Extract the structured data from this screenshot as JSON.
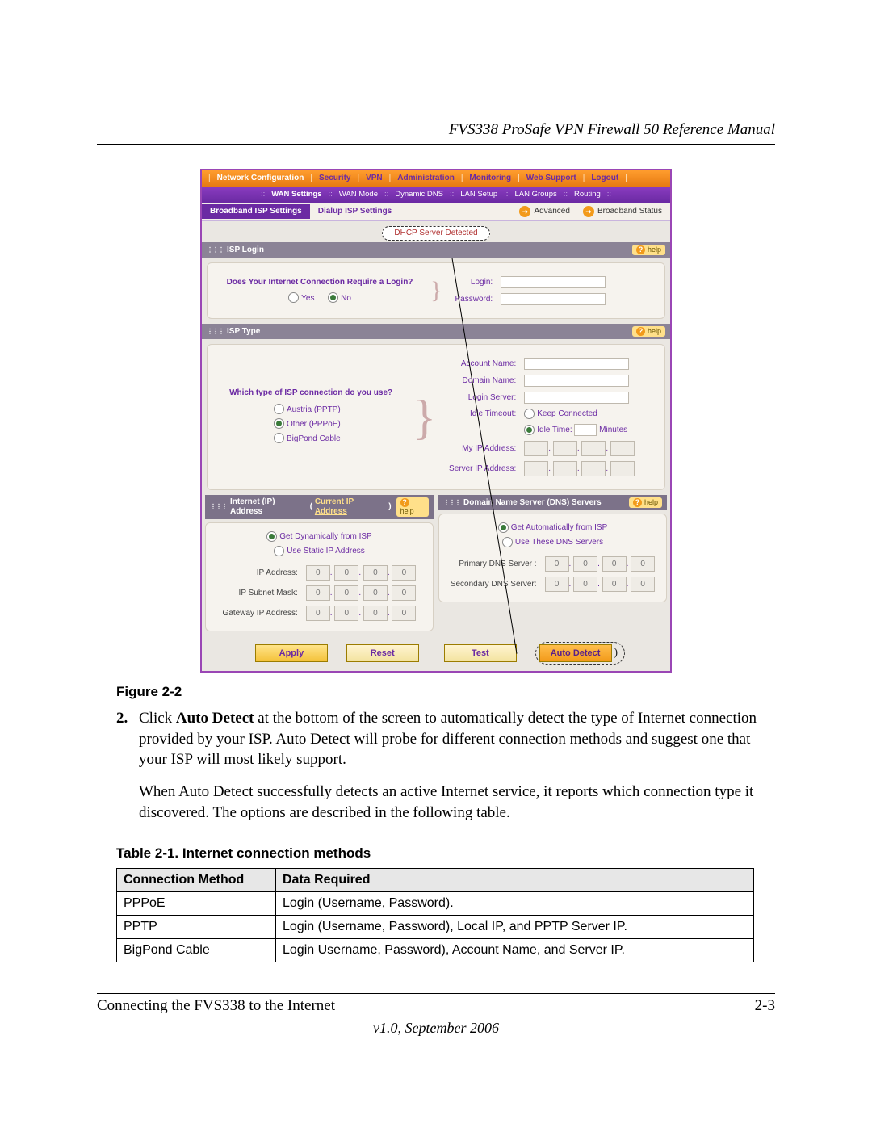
{
  "header_title": "FVS338 ProSafe VPN Firewall 50 Reference Manual",
  "nav": {
    "primary": [
      "Network Configuration",
      "Security",
      "VPN",
      "Administration",
      "Monitoring",
      "Web Support",
      "Logout"
    ],
    "primary_active_index": 0,
    "sub": [
      "WAN Settings",
      "WAN Mode",
      "Dynamic DNS",
      "LAN Setup",
      "LAN Groups",
      "Routing"
    ],
    "sub_active_index": 0
  },
  "tabs": {
    "items": [
      "Broadband ISP Settings",
      "Dialup ISP Settings"
    ],
    "active_index": 0,
    "right_links": {
      "advanced": "Advanced",
      "broadband_status": "Broadband Status"
    }
  },
  "dhcp_pill": "DHCP Server Detected",
  "isp_login": {
    "title": "ISP Login",
    "question": "Does Your Internet Connection Require a Login?",
    "yes": "Yes",
    "no": "No",
    "selected": "no",
    "login_label": "Login:",
    "password_label": "Password:",
    "login_value": "",
    "password_value": ""
  },
  "isp_type": {
    "title": "ISP Type",
    "question": "Which type of ISP connection do you use?",
    "options": {
      "austria": "Austria (PPTP)",
      "other": "Other (PPPoE)",
      "bigpond": "BigPond Cable"
    },
    "selected": "other",
    "labels": {
      "account_name": "Account Name:",
      "domain_name": "Domain Name:",
      "login_server": "Login Server:",
      "idle_timeout": "Idle Timeout:",
      "keep_connected": "Keep Connected",
      "idle_time": "Idle Time:",
      "minutes": "Minutes",
      "my_ip": "My IP Address:",
      "server_ip": "Server IP Address:"
    }
  },
  "ip_section": {
    "title_left": "Internet (IP) Address",
    "current_link": "Current IP Address",
    "opt_dynamic": "Get Dynamically from ISP",
    "opt_static": "Use Static IP Address",
    "selected": "dynamic",
    "labels": {
      "ip": "IP Address:",
      "mask": "IP Subnet Mask:",
      "gw": "Gateway IP Address:"
    },
    "octet_placeholder": "0"
  },
  "dns_section": {
    "title_right": "Domain Name Server (DNS) Servers",
    "opt_auto": "Get Automatically from ISP",
    "opt_manual": "Use These DNS Servers",
    "selected": "auto",
    "labels": {
      "primary": "Primary DNS Server :",
      "secondary": "Secondary DNS Server:"
    }
  },
  "help_label": "help",
  "buttons": {
    "apply": "Apply",
    "reset": "Reset",
    "test": "Test",
    "auto_detect": "Auto Detect"
  },
  "figure_caption": "Figure 2-2",
  "step": {
    "num": "2.",
    "para1_a": "Click ",
    "para1_bold": "Auto Detect",
    "para1_b": " at the bottom of the screen to automatically detect the type of Internet connection provided by your ISP. Auto Detect will probe for different connection methods and suggest one that your ISP will most likely support.",
    "para2": "When Auto Detect successfully detects an active Internet service, it reports which connection type it discovered. The options are described in the following table."
  },
  "table": {
    "caption": "Table 2-1. Internet connection methods",
    "head": {
      "c1": "Connection Method",
      "c2": "Data Required"
    },
    "rows": [
      {
        "c1": "PPPoE",
        "c2": "Login (Username, Password)."
      },
      {
        "c1": "PPTP",
        "c2": "Login (Username, Password), Local IP, and PPTP Server IP."
      },
      {
        "c1": "BigPond Cable",
        "c2": "Login Username, Password), Account Name, and Server IP."
      }
    ]
  },
  "footer": {
    "left": "Connecting the FVS338 to the Internet",
    "right": "2-3",
    "version": "v1.0, September 2006"
  }
}
